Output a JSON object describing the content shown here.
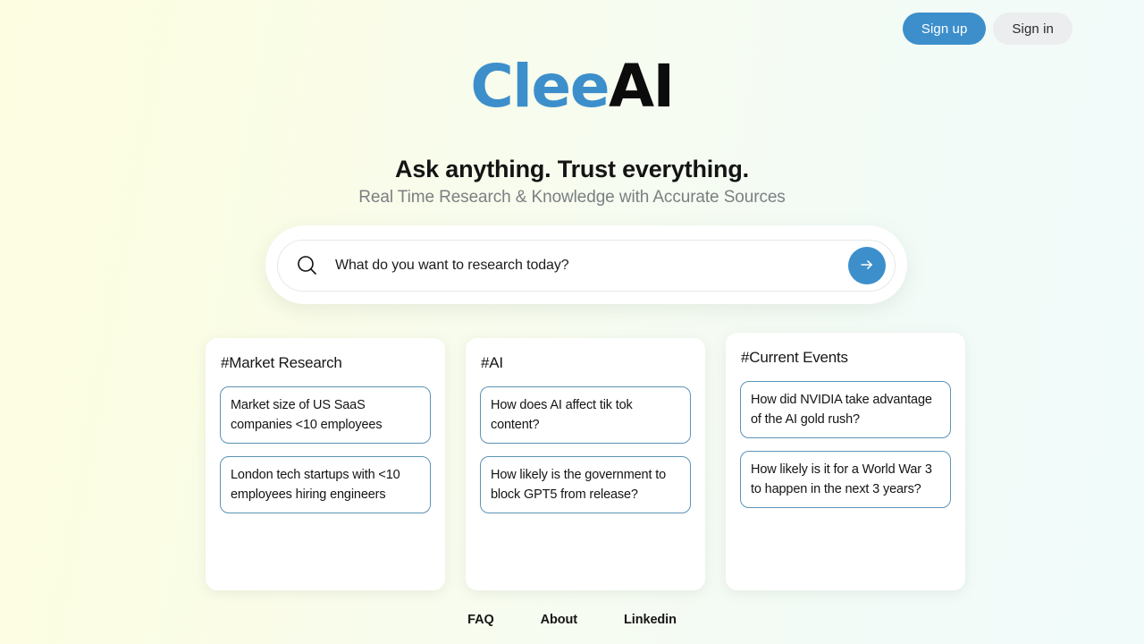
{
  "colors": {
    "brand_blue": "#3d8fcb",
    "brand_black": "#0c0c0c",
    "chip_border": "#5d93b7",
    "signin_bg": "#ecedee",
    "bg_left": "#fcfde1",
    "bg_right": "#f1fbfa"
  },
  "auth": {
    "sign_up": "Sign up",
    "sign_in": "Sign in"
  },
  "logo": {
    "part1": "Clee",
    "part2": "AI"
  },
  "hero": {
    "headline": "Ask anything. Trust everything.",
    "subheadline": "Real Time Research & Knowledge with Accurate Sources"
  },
  "search": {
    "placeholder": "What do you want to research today?",
    "value": "",
    "icon": "search-icon",
    "submit_icon": "arrow-right-icon"
  },
  "cards": [
    {
      "title": "#Market Research",
      "chips": [
        "Market size of US SaaS companies <10 employees",
        "London tech startups with <10 employees hiring engineers"
      ]
    },
    {
      "title": "#AI",
      "chips": [
        "How does AI affect tik tok content?",
        "How likely is the government to block GPT5 from release?"
      ]
    },
    {
      "title": "#Current Events",
      "chips": [
        "How did NVIDIA take advantage of the AI gold rush?",
        "How likely is it for a World War 3 to happen in the next 3 years?"
      ]
    }
  ],
  "footer": {
    "links": [
      "FAQ",
      "About",
      "Linkedin"
    ]
  }
}
